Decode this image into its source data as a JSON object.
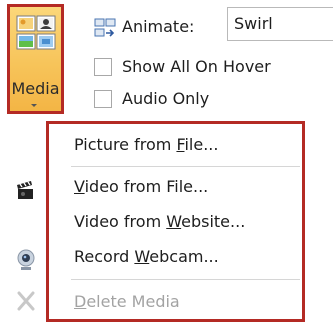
{
  "media": {
    "label": "Media"
  },
  "animate": {
    "label": "Animate:",
    "value": "Swirl"
  },
  "checkboxes": [
    {
      "label": "Show All On Hover",
      "checked": false
    },
    {
      "label": "Audio Only",
      "checked": false
    }
  ],
  "menu": {
    "items": [
      {
        "pre": "Picture from ",
        "key": "F",
        "post": "ile...",
        "enabled": true
      },
      {
        "pre": "",
        "key": "V",
        "post": "ideo from File...",
        "enabled": true
      },
      {
        "pre": "Video from ",
        "key": "W",
        "post": "ebsite...",
        "enabled": true
      },
      {
        "pre": "Record ",
        "key": "W",
        "post": "ebcam...",
        "enabled": true
      },
      {
        "pre": "",
        "key": "D",
        "post": "elete Media",
        "enabled": false
      }
    ]
  },
  "colors": {
    "highlight_border": "#b42a24",
    "disabled_text": "#a3a3a3"
  },
  "icons": {
    "media": "media-insert-icon",
    "animate": "animate-icon",
    "side": [
      "clapperboard-icon",
      "webcam-icon",
      "delete-x-icon"
    ]
  }
}
